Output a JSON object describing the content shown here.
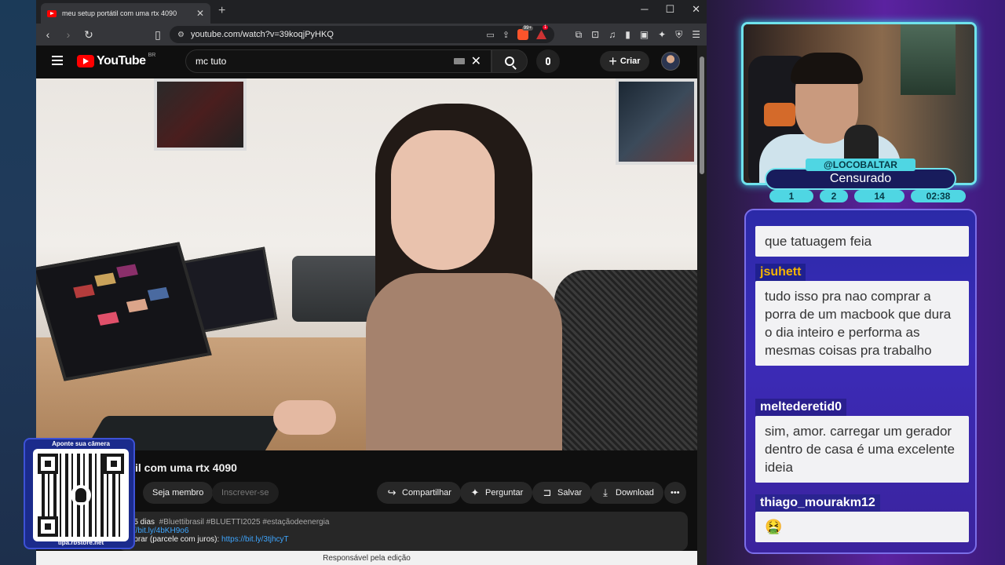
{
  "browser": {
    "tab_title": "meu setup portátil com uma rtx 4090",
    "tab_close": "✕",
    "new_tab": "+",
    "url": "youtube.com/watch?v=39koqjPyHKQ",
    "brave_badge": "99+",
    "rewards_badge": "1"
  },
  "youtube": {
    "logo": "YouTube",
    "country": "BR",
    "search_value": "mc tuto",
    "create_label": "Criar",
    "video_title": "il com uma rtx 4090",
    "buttons": {
      "join": "Seja membro",
      "subscribe": "Inscrever-se",
      "share": "Compartilhar",
      "ask": "Perguntar",
      "save": "Salvar",
      "download": "Download",
      "more": "•••"
    },
    "description": {
      "age": "á 5 dias",
      "tags": "#Bluettibrasil #BLUETTI2025 #estaçãodeenergia",
      "link1": "s://bit.ly/4bKH9o6",
      "line3_text": "mprar (parcele com juros): ",
      "line3_link": "https://bit.ly/3tjhcyT"
    },
    "status_bar": "Responsável pela edição"
  },
  "qr_overlay": {
    "top": "Aponte sua câmera",
    "bottom": "tipa.rbstore.net"
  },
  "stream": {
    "handle": "@LOCOBALTAR",
    "title": "Censurado",
    "stats": [
      "1",
      "2",
      "14",
      "02:38"
    ]
  },
  "chat": {
    "messages": [
      {
        "user": "",
        "text": "que tatuagem feia"
      },
      {
        "user": "jsuhett",
        "text": "tudo isso pra nao comprar a porra de um macbook que dura o dia inteiro e performa as mesmas coisas pra trabalho",
        "color": "#f5b400"
      },
      {
        "user": "meltederetid0",
        "text": "sim, amor. carregar um gerador dentro de casa é uma excelente ideia",
        "color": "#ffffff"
      },
      {
        "user": "thiago_mourakm12",
        "text": "🤮",
        "color": "#ffffff"
      }
    ]
  },
  "colors": {
    "accent_cyan": "#6fe3ec",
    "chat_bg": "#2f2bb0",
    "yt_red": "#ff0000"
  }
}
